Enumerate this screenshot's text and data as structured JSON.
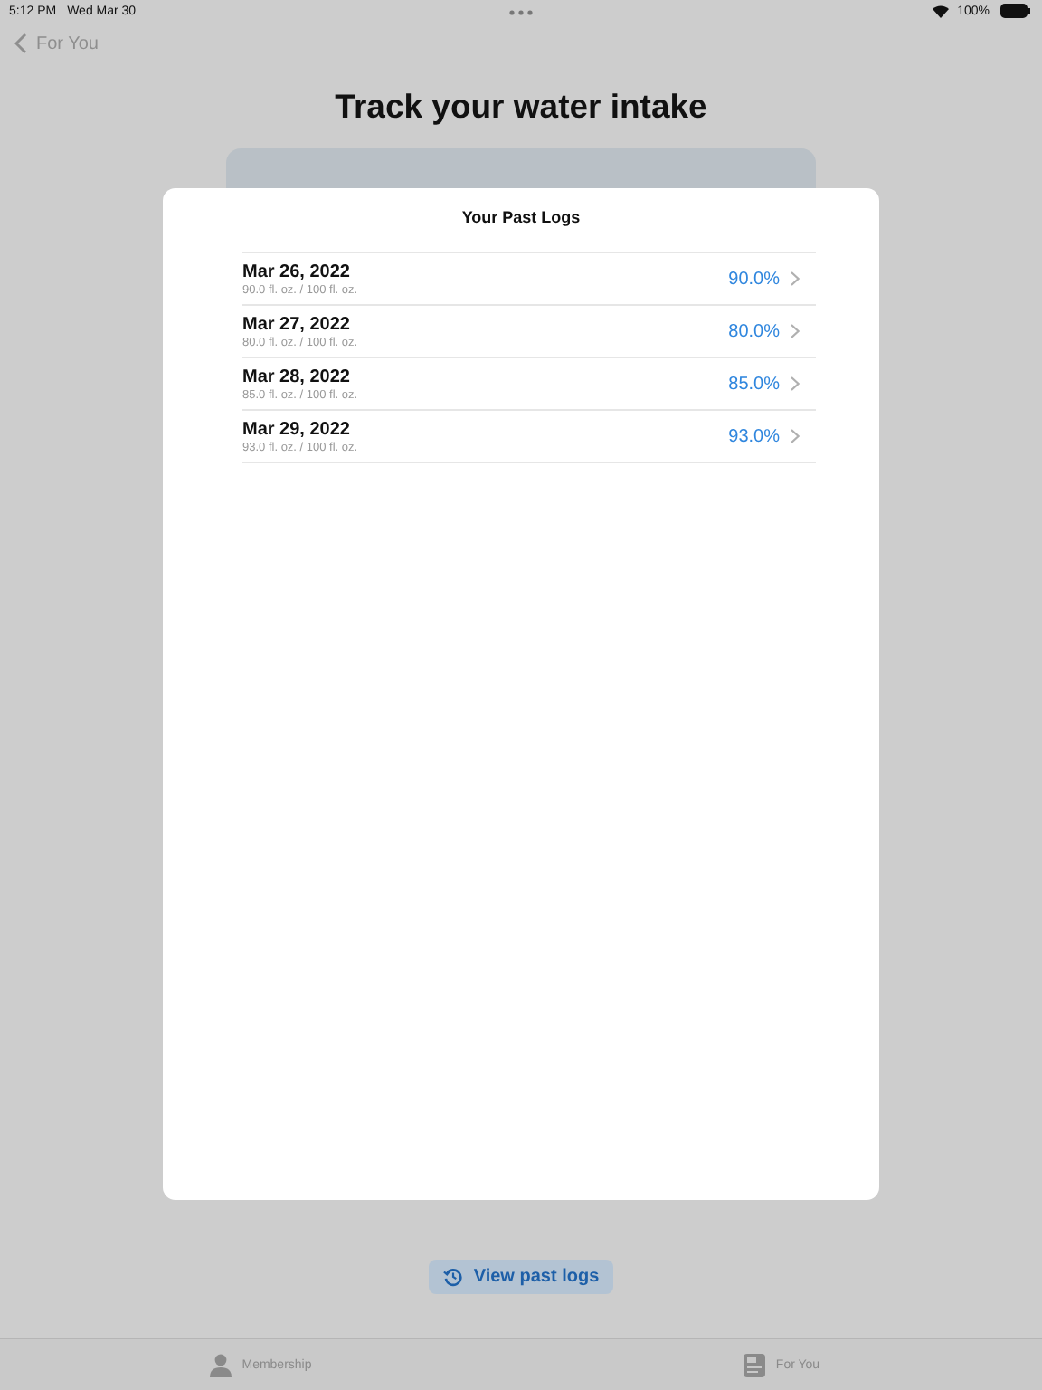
{
  "status_bar": {
    "time": "5:12 PM",
    "date": "Wed Mar 30",
    "battery": "100%"
  },
  "nav": {
    "back_label": "For You"
  },
  "title": "Track your water intake",
  "modal": {
    "title": "Your Past Logs",
    "logs": [
      {
        "date": "Mar 26, 2022",
        "amount": "90.0 fl. oz. / 100 fl. oz.",
        "percent": "90.0%"
      },
      {
        "date": "Mar 27, 2022",
        "amount": "80.0 fl. oz. / 100 fl. oz.",
        "percent": "80.0%"
      },
      {
        "date": "Mar 28, 2022",
        "amount": "85.0 fl. oz. / 100 fl. oz.",
        "percent": "85.0%"
      },
      {
        "date": "Mar 29, 2022",
        "amount": "93.0 fl. oz. / 100 fl. oz.",
        "percent": "93.0%"
      }
    ]
  },
  "view_button": "View past logs",
  "tab_bar": [
    {
      "label": "Membership",
      "kind": "person",
      "selected": false
    },
    {
      "label": "For You",
      "kind": "news",
      "selected": false
    }
  ]
}
